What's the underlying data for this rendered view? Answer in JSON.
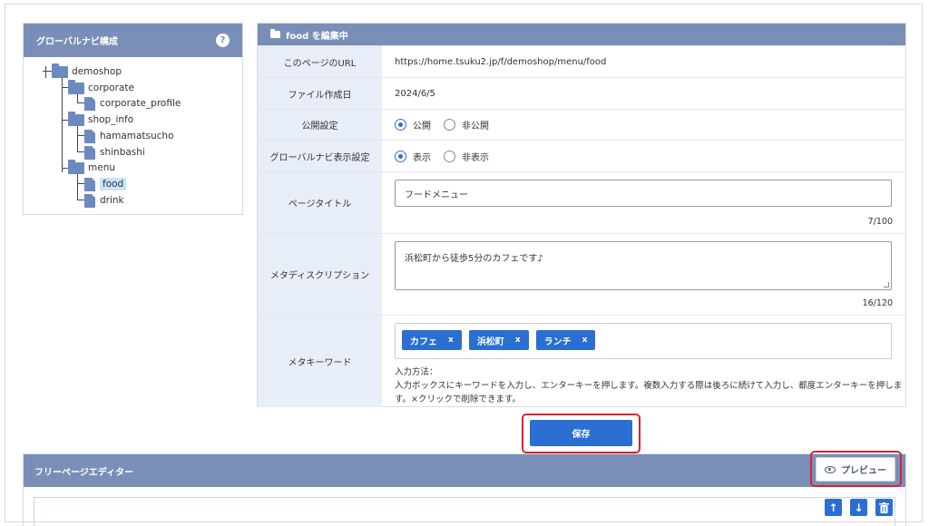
{
  "nav": {
    "title": "グローバルナビ構成",
    "help": "?",
    "tree": {
      "root": "demoshop",
      "corporate": "corporate",
      "corporate_profile": "corporate_profile",
      "shop_info": "shop_info",
      "hamamatsucho": "hamamatsucho",
      "shinbashi": "shinbashi",
      "menu": "menu",
      "food": "food",
      "drink": "drink"
    }
  },
  "form": {
    "title": "food を編集中",
    "url_label": "このページのURL",
    "url_value": "https://home.tsuku2.jp/f/demoshop/menu/food",
    "created_label": "ファイル作成日",
    "created_value": "2024/6/5",
    "publish_label": "公開設定",
    "publish_on": "公開",
    "publish_off": "非公開",
    "nav_label": "グローバルナビ表示設定",
    "nav_on": "表示",
    "nav_off": "非表示",
    "page_title_label": "ページタイトル",
    "page_title_value": "フードメニュー",
    "page_title_count": "7/100",
    "meta_desc_label": "メタディスクリプション",
    "meta_desc_value": "浜松町から徒歩5分のカフェです♪",
    "meta_desc_count": "16/120",
    "meta_kw_label": "メタキーワード",
    "keywords": [
      "カフェ",
      "浜松町",
      "ランチ"
    ],
    "kw_remove": "x",
    "help_title": "入力方法：",
    "help_body": "入力ボックスにキーワードを入力し、エンターキーを押します。複数入力する際は後ろに続けて入力し、都度エンターキーを押します。×クリックで削除できます。"
  },
  "save_label": "保存",
  "editor": {
    "title": "フリーページエディター",
    "preview_label": "プレビュー",
    "up": "↑",
    "down": "↓"
  },
  "colors": {
    "header": "#7a8fb8",
    "primary": "#2a6fd1",
    "label_bg": "#e7eef7",
    "highlight": "#d9232e"
  }
}
